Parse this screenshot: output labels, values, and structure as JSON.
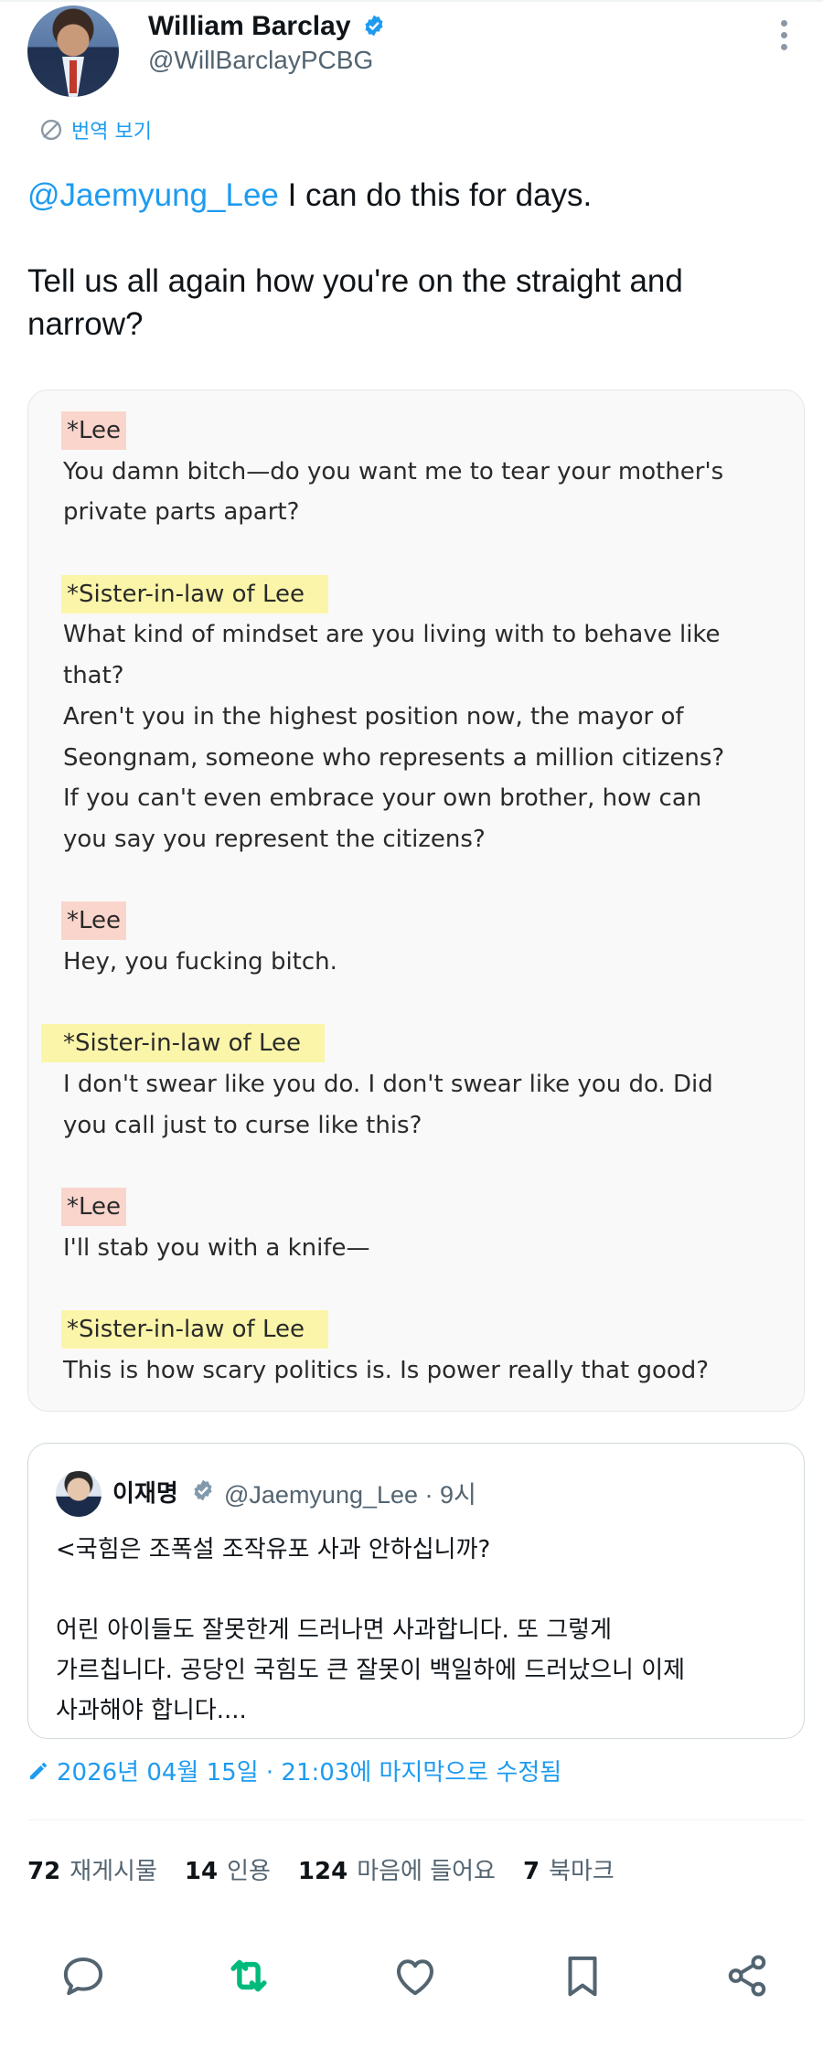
{
  "author": {
    "name": "William Barclay",
    "handle": "@WillBarclayPCBG"
  },
  "translate_label": "번역 보기",
  "tweet": {
    "mention": "@Jaemyung_Lee",
    "line1_rest": " I can do this for days.",
    "line2": "Tell us all again how you're on the straight and",
    "line3": "narrow?"
  },
  "transcript": {
    "s1_speaker": "*Lee",
    "s1_l1": "You damn bitch—do you want me to tear your mother's",
    "s1_l2": "private parts apart?",
    "s2_speaker": "*Sister-in-law of Lee",
    "s2_l1": "What kind of mindset are you living with to behave like",
    "s2_l2": "that?",
    "s2_l3": "Aren't you in the highest position now, the mayor of",
    "s2_l4": "Seongnam, someone who represents a million citizens?",
    "s2_l5": "If you can't even embrace your own brother, how can",
    "s2_l6": "you say you represent the citizens?",
    "s3_speaker": "*Lee",
    "s3_l1": "Hey, you fucking bitch.",
    "s4_speaker": "*Sister-in-law of Lee",
    "s4_l1": "I don't swear like you do. I don't swear like you do. Did",
    "s4_l2": "you call just to curse like this?",
    "s5_speaker": "*Lee",
    "s5_l1": "I'll stab you with a knife—",
    "s6_speaker": "*Sister-in-law of Lee",
    "s6_l1": "This is how scary politics is. Is power really that good?"
  },
  "quote": {
    "name": "이재명",
    "handle_time": "@Jaemyung_Lee · 9시",
    "l1": "<국힘은 조폭설 조작유포 사과 안하십니까?",
    "l2": "어린 아이들도 잘못한게 드러나면 사과합니다. 또 그렇게",
    "l3": "가르칩니다. 공당인 국힘도 큰 잘못이 백일하에 드러났으니 이제",
    "l4": "사과해야 합니다...."
  },
  "edited_label": "2026년 04월 15일 · 21:03에 마지막으로 수정됨",
  "stats": {
    "reposts_count": "72",
    "reposts_label": "재게시물",
    "quotes_count": "14",
    "quotes_label": "인용",
    "likes_count": "124",
    "likes_label": "마음에 들어요",
    "bookmarks_count": "7",
    "bookmarks_label": "북마크"
  },
  "icons": [
    "verified-badge-icon",
    "more-icon",
    "translate-icon",
    "pencil-icon",
    "reply-icon",
    "repost-icon",
    "like-icon",
    "bookmark-icon",
    "share-icon"
  ],
  "colors": {
    "accent": "#1d9bf0",
    "repost_active": "#00ba7c",
    "highlight_lee": "#f9d5cc",
    "highlight_sister": "#fbf5a9",
    "secondary_text": "#536471"
  }
}
